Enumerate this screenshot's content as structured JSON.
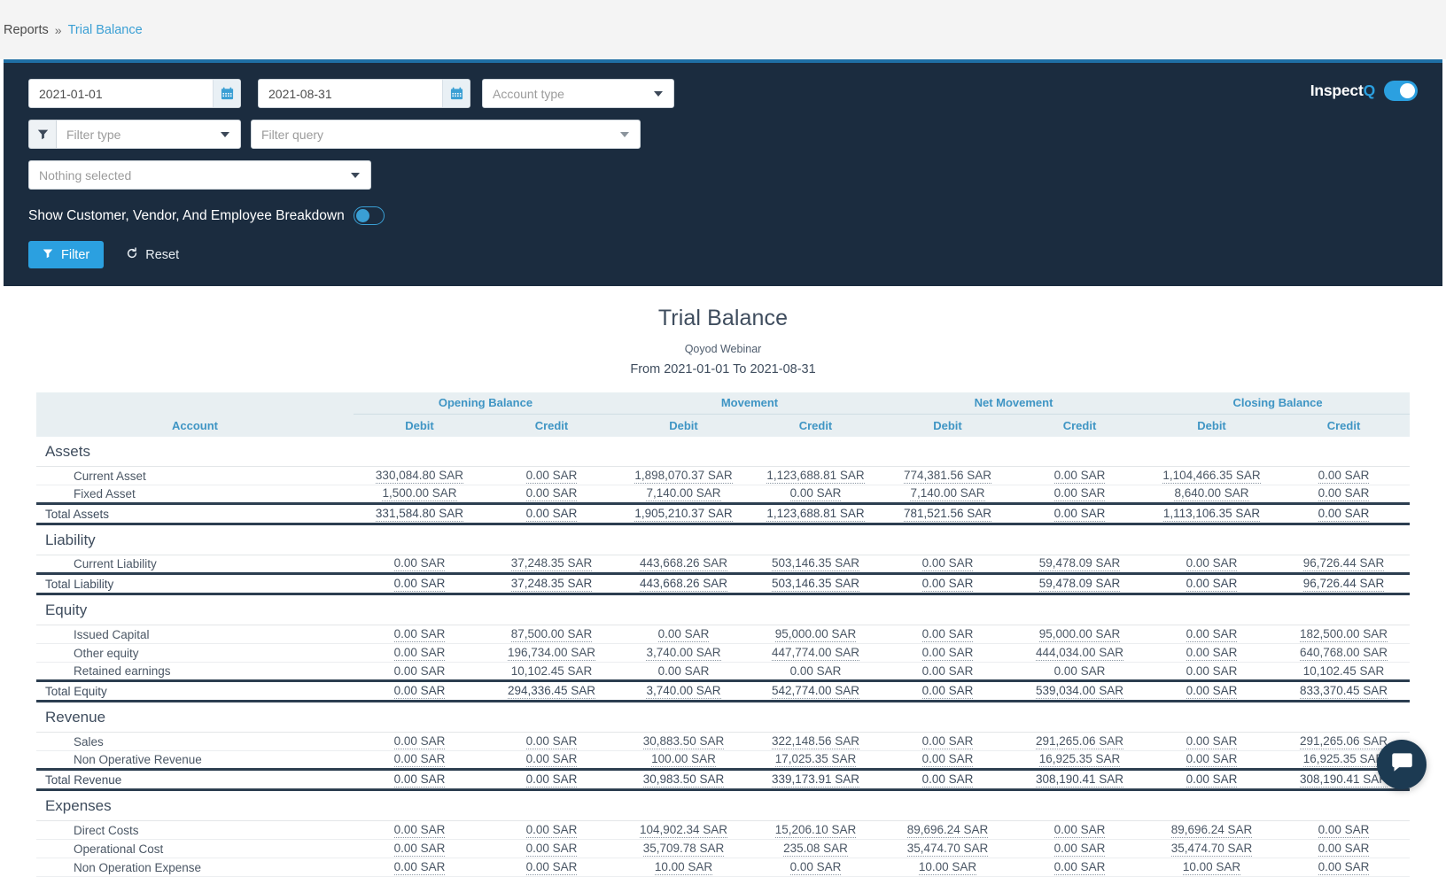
{
  "breadcrumb": {
    "root": "Reports",
    "separator": "»",
    "current": "Trial Balance"
  },
  "filters": {
    "date_from": "2021-01-01",
    "date_to": "2021-08-31",
    "account_type_placeholder": "Account type",
    "filter_type_placeholder": "Filter type",
    "filter_query_placeholder": "Filter query",
    "nothing_selected": "Nothing selected",
    "breakdown_label": "Show Customer, Vendor, And Employee Breakdown",
    "filter_button": "Filter",
    "reset_button": "Reset",
    "inspect_label": "Inspect",
    "inspect_q": "Q",
    "accent_color": "#2ba0e0",
    "panel_color": "#1b2c3f"
  },
  "report": {
    "title": "Trial Balance",
    "company": "Qoyod Webinar",
    "range": "From 2021-01-01 To 2021-08-31"
  },
  "chart_data": {
    "type": "table",
    "title": "Trial Balance",
    "column_groups": [
      "Opening Balance",
      "Movement",
      "Net Movement",
      "Closing Balance"
    ],
    "columns": [
      "Account",
      "Debit",
      "Credit",
      "Debit",
      "Credit",
      "Debit",
      "Credit",
      "Debit",
      "Credit"
    ],
    "sections": [
      {
        "name": "Assets",
        "rows": [
          {
            "account": "Current Asset",
            "values": [
              "330,084.80 SAR",
              "0.00 SAR",
              "1,898,070.37 SAR",
              "1,123,688.81 SAR",
              "774,381.56 SAR",
              "0.00 SAR",
              "1,104,466.35 SAR",
              "0.00 SAR"
            ],
            "underline": true
          },
          {
            "account": "Fixed Asset",
            "values": [
              "1,500.00 SAR",
              "0.00 SAR",
              "7,140.00 SAR",
              "0.00 SAR",
              "7,140.00 SAR",
              "0.00 SAR",
              "8,640.00 SAR",
              "0.00 SAR"
            ],
            "underline": true
          }
        ],
        "total": {
          "account": "Total Assets",
          "values": [
            "331,584.80 SAR",
            "0.00 SAR",
            "1,905,210.37 SAR",
            "1,123,688.81 SAR",
            "781,521.56 SAR",
            "0.00 SAR",
            "1,113,106.35 SAR",
            "0.00 SAR"
          ],
          "underline": true
        }
      },
      {
        "name": "Liability",
        "rows": [
          {
            "account": "Current Liability",
            "values": [
              "0.00 SAR",
              "37,248.35 SAR",
              "443,668.26 SAR",
              "503,146.35 SAR",
              "0.00 SAR",
              "59,478.09 SAR",
              "0.00 SAR",
              "96,726.44 SAR"
            ],
            "underline": true
          }
        ],
        "total": {
          "account": "Total Liability",
          "values": [
            "0.00 SAR",
            "37,248.35 SAR",
            "443,668.26 SAR",
            "503,146.35 SAR",
            "0.00 SAR",
            "59,478.09 SAR",
            "0.00 SAR",
            "96,726.44 SAR"
          ],
          "underline": true
        }
      },
      {
        "name": "Equity",
        "rows": [
          {
            "account": "Issued Capital",
            "values": [
              "0.00 SAR",
              "87,500.00 SAR",
              "0.00 SAR",
              "95,000.00 SAR",
              "0.00 SAR",
              "95,000.00 SAR",
              "0.00 SAR",
              "182,500.00 SAR"
            ],
            "underline": true
          },
          {
            "account": "Other equity",
            "values": [
              "0.00 SAR",
              "196,734.00 SAR",
              "3,740.00 SAR",
              "447,774.00 SAR",
              "0.00 SAR",
              "444,034.00 SAR",
              "0.00 SAR",
              "640,768.00 SAR"
            ],
            "underline": true
          },
          {
            "account": "Retained earnings",
            "values": [
              "0.00 SAR",
              "10,102.45 SAR",
              "0.00 SAR",
              "0.00 SAR",
              "0.00 SAR",
              "0.00 SAR",
              "0.00 SAR",
              "10,102.45 SAR"
            ],
            "underline": false
          }
        ],
        "total": {
          "account": "Total Equity",
          "values": [
            "0.00 SAR",
            "294,336.45 SAR",
            "3,740.00 SAR",
            "542,774.00 SAR",
            "0.00 SAR",
            "539,034.00 SAR",
            "0.00 SAR",
            "833,370.45 SAR"
          ],
          "underline": true
        }
      },
      {
        "name": "Revenue",
        "rows": [
          {
            "account": "Sales",
            "values": [
              "0.00 SAR",
              "0.00 SAR",
              "30,883.50 SAR",
              "322,148.56 SAR",
              "0.00 SAR",
              "291,265.06 SAR",
              "0.00 SAR",
              "291,265.06 SAR"
            ],
            "underline": true
          },
          {
            "account": "Non Operative Revenue",
            "values": [
              "0.00 SAR",
              "0.00 SAR",
              "100.00 SAR",
              "17,025.35 SAR",
              "0.00 SAR",
              "16,925.35 SAR",
              "0.00 SAR",
              "16,925.35 SAR"
            ],
            "underline": true
          }
        ],
        "total": {
          "account": "Total Revenue",
          "values": [
            "0.00 SAR",
            "0.00 SAR",
            "30,983.50 SAR",
            "339,173.91 SAR",
            "0.00 SAR",
            "308,190.41 SAR",
            "0.00 SAR",
            "308,190.41 SAR"
          ],
          "underline": true
        }
      },
      {
        "name": "Expenses",
        "rows": [
          {
            "account": "Direct Costs",
            "values": [
              "0.00 SAR",
              "0.00 SAR",
              "104,902.34 SAR",
              "15,206.10 SAR",
              "89,696.24 SAR",
              "0.00 SAR",
              "89,696.24 SAR",
              "0.00 SAR"
            ],
            "underline": true
          },
          {
            "account": "Operational Cost",
            "values": [
              "0.00 SAR",
              "0.00 SAR",
              "35,709.78 SAR",
              "235.08 SAR",
              "35,474.70 SAR",
              "0.00 SAR",
              "35,474.70 SAR",
              "0.00 SAR"
            ],
            "underline": true
          },
          {
            "account": "Non Operation Expense",
            "values": [
              "0.00 SAR",
              "0.00 SAR",
              "10.00 SAR",
              "0.00 SAR",
              "10.00 SAR",
              "0.00 SAR",
              "10.00 SAR",
              "0.00 SAR"
            ],
            "underline": true
          }
        ],
        "total": null
      }
    ]
  }
}
